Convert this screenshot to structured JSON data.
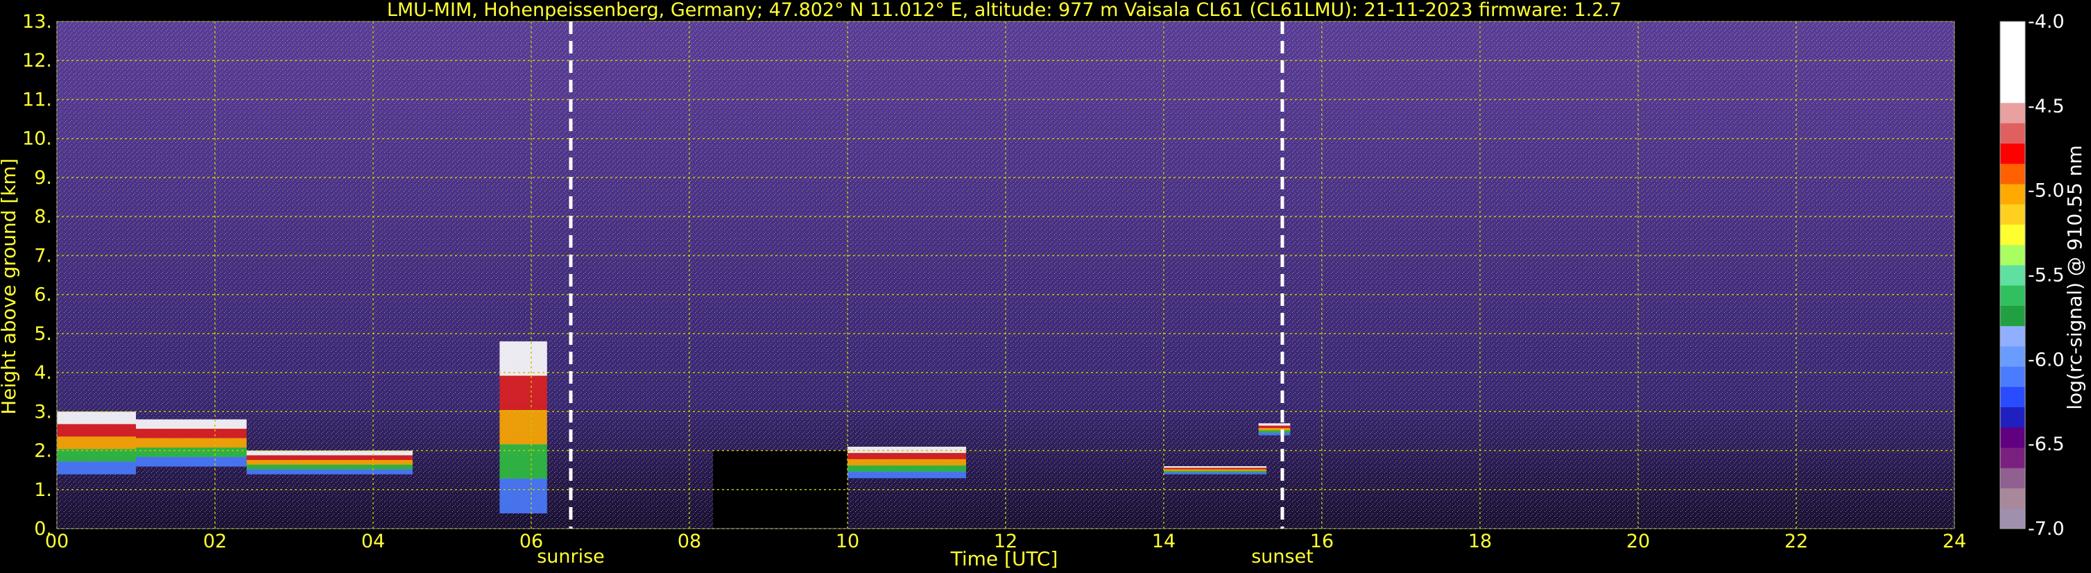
{
  "title": "LMU-MIM, Hohenpeissenberg, Germany; 47.802° N 11.012° E, altitude: 977 m    Vaisala CL61 (CL61LMU): 21-11-2023    firmware: 1.2.7",
  "chart_data": {
    "type": "heatmap",
    "xlabel": "Time [UTC]",
    "ylabel": "Height above ground [km]",
    "xlim": [
      0,
      24
    ],
    "ylim": [
      0,
      13
    ],
    "x_ticks": [
      "00",
      "02",
      "04",
      "06",
      "08",
      "10",
      "12",
      "14",
      "16",
      "18",
      "20",
      "22",
      "24"
    ],
    "y_ticks": [
      "0.",
      "1.",
      "2.",
      "3.",
      "4.",
      "5.",
      "6.",
      "7.",
      "8.",
      "9.",
      "10.",
      "11.",
      "12.",
      "13."
    ],
    "grid": true,
    "annotations": [
      {
        "label": "sunrise",
        "x": 6.5
      },
      {
        "label": "sunset",
        "x": 15.5
      }
    ],
    "colorbar": {
      "label": "log(rc-signal) @ 910.55 nm",
      "range": [
        -7.0,
        -4.0
      ],
      "ticks": [
        "-4.0",
        "-4.5",
        "-5.0",
        "-5.5",
        "-6.0",
        "-6.5",
        "-7.0"
      ]
    },
    "data_gaps": [
      [
        8.3,
        10.0
      ]
    ],
    "cloud_layers": [
      {
        "start": 0.0,
        "end": 1.0,
        "base": 1.4,
        "top": 3.0
      },
      {
        "start": 1.0,
        "end": 2.4,
        "base": 1.6,
        "top": 2.8
      },
      {
        "start": 2.4,
        "end": 4.5,
        "base": 1.4,
        "top": 2.0
      },
      {
        "start": 5.6,
        "end": 6.2,
        "base": 0.4,
        "top": 4.8
      },
      {
        "start": 10.0,
        "end": 11.5,
        "base": 1.3,
        "top": 2.1
      },
      {
        "start": 14.0,
        "end": 15.3,
        "base": 1.4,
        "top": 1.6
      },
      {
        "start": 15.2,
        "end": 15.6,
        "base": 2.4,
        "top": 2.7
      }
    ]
  },
  "colors": {
    "text": "#ffff33",
    "background": "#000000",
    "noise": "#5a3d94",
    "grid": "#c8c800"
  }
}
